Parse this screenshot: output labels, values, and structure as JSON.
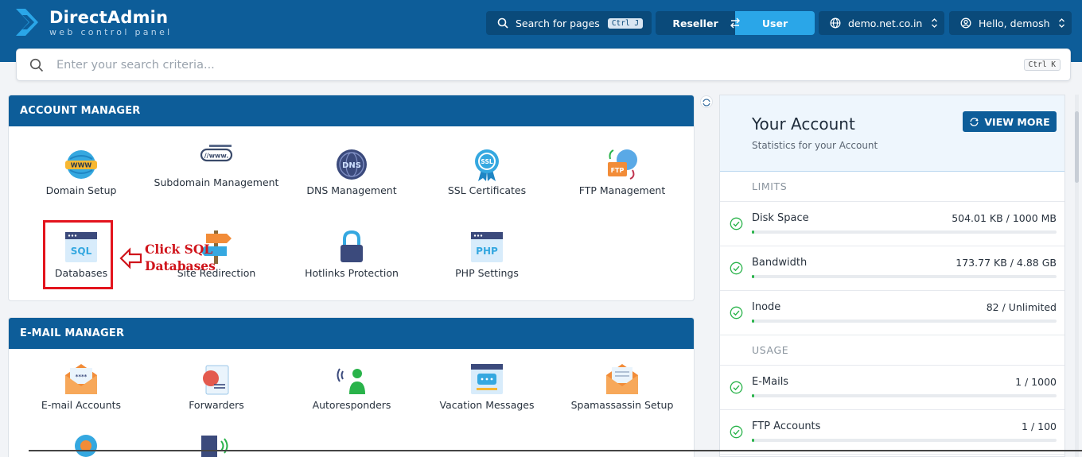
{
  "app": {
    "name": "DirectAdmin",
    "tagline": "web control panel"
  },
  "topbar": {
    "search_pages_label": "Search for pages",
    "search_pages_shortcut": "Ctrl J",
    "role_reseller": "Reseller",
    "role_user": "User",
    "domain": "demo.net.co.in",
    "greeting": "Hello, demosh"
  },
  "search": {
    "placeholder": "Enter your search criteria...",
    "shortcut": "Ctrl K"
  },
  "account_manager": {
    "title": "ACCOUNT MANAGER",
    "items": [
      {
        "label": "Domain Setup",
        "icon": "www-globe-icon"
      },
      {
        "label": "Subdomain Management",
        "icon": "subdomain-icon"
      },
      {
        "label": "DNS Management",
        "icon": "dns-icon"
      },
      {
        "label": "SSL Certificates",
        "icon": "ssl-badge-icon"
      },
      {
        "label": "FTP Management",
        "icon": "ftp-icon"
      },
      {
        "label": "Databases",
        "icon": "sql-database-icon"
      },
      {
        "label": "Site Redirection",
        "icon": "signpost-icon"
      },
      {
        "label": "Hotlinks Protection",
        "icon": "lock-icon"
      },
      {
        "label": "PHP Settings",
        "icon": "php-icon"
      }
    ]
  },
  "annotation": {
    "line1": "Click SQL",
    "line2": "Databases"
  },
  "email_manager": {
    "title": "E-MAIL MANAGER",
    "items": [
      {
        "label": "E-mail Accounts",
        "icon": "email-accounts-icon"
      },
      {
        "label": "Forwarders",
        "icon": "forwarders-icon"
      },
      {
        "label": "Autoresponders",
        "icon": "autoresponder-icon"
      },
      {
        "label": "Vacation Messages",
        "icon": "vacation-message-icon"
      },
      {
        "label": "Spamassassin Setup",
        "icon": "spam-icon"
      }
    ]
  },
  "your_account": {
    "title": "Your Account",
    "subtitle": "Statistics for your Account",
    "view_more": "VIEW MORE",
    "limits_label": "LIMITS",
    "usage_label": "USAGE",
    "limits": [
      {
        "name": "Disk Space",
        "value": "504.01 KB / 1000 MB",
        "fill": 0.005
      },
      {
        "name": "Bandwidth",
        "value": "173.77 KB / 4.88 GB",
        "fill": 0.005
      },
      {
        "name": "Inode",
        "value": "82 / Unlimited",
        "fill": 0.0
      }
    ],
    "usage": [
      {
        "name": "E-Mails",
        "value": "1 / 1000",
        "fill": 0.004
      },
      {
        "name": "FTP Accounts",
        "value": "1 / 100",
        "fill": 0.004
      }
    ]
  },
  "colors": {
    "brand": "#0d5d99",
    "accent": "#2aa6e8",
    "highlight": "#e3141d",
    "success": "#29b34a"
  }
}
